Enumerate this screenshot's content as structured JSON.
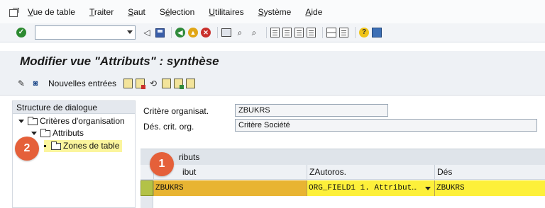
{
  "menubar": {
    "items": [
      {
        "label_prefix": "",
        "accel": "V",
        "label_rest": "ue de table"
      },
      {
        "label_prefix": "",
        "accel": "T",
        "label_rest": "raiter"
      },
      {
        "label_prefix": "",
        "accel": "S",
        "label_rest": "aut"
      },
      {
        "label_prefix": "S",
        "accel": "é",
        "label_rest": "lection"
      },
      {
        "label_prefix": "",
        "accel": "U",
        "label_rest": "tilitaires"
      },
      {
        "label_prefix": "",
        "accel": "S",
        "label_rest": "ystème"
      },
      {
        "label_prefix": "",
        "accel": "A",
        "label_rest": "ide"
      }
    ]
  },
  "toolbar": {
    "command_value": ""
  },
  "title": {
    "text": "Modifier vue \"Attributs\" : synthèse"
  },
  "apptoolbar": {
    "new_entries_label": "Nouvelles entrées"
  },
  "tree": {
    "header": "Structure de dialogue",
    "nodes": {
      "criteres": "Critères d'organisation",
      "attributs": "Attributs",
      "zones": "Zones de table"
    }
  },
  "form": {
    "critere_label": "Critère organisat.",
    "critere_value": "ZBUKRS",
    "des_label": "Dés. crit. org.",
    "des_value": "Critère Société"
  },
  "table": {
    "title_partial": "ributs",
    "headers": {
      "col1_partial": "ibut",
      "col2": "ZAutoros.",
      "col3": "Dés"
    },
    "row": {
      "col1": "ZBUKRS",
      "col2": "ORG_FIELD1 1. Attribut…",
      "col3": "ZBUKRS"
    }
  },
  "callouts": {
    "one": "1",
    "two": "2"
  },
  "colors": {
    "callout": "#e5603a",
    "row_highlight": "#fdf03a",
    "cell_highlight": "#e8b432",
    "tree_highlight": "#fbf59d"
  }
}
